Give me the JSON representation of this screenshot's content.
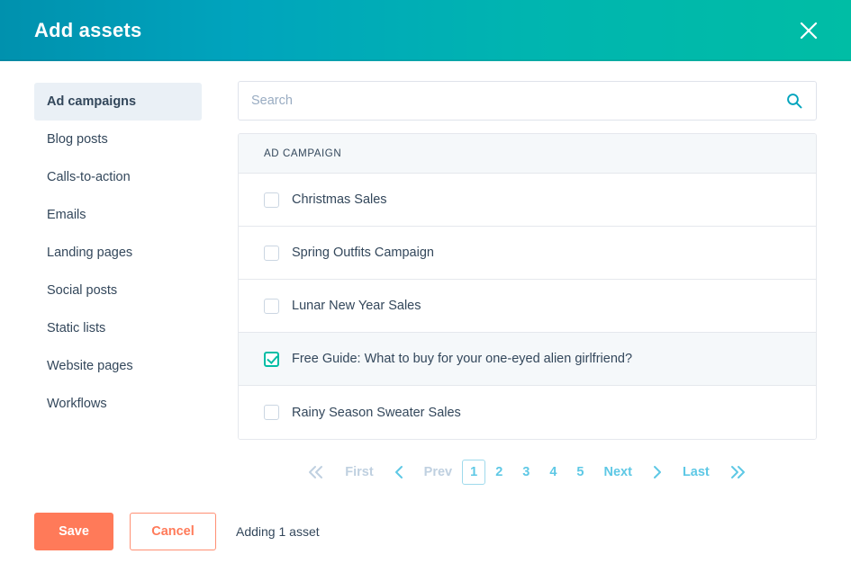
{
  "header": {
    "title": "Add assets",
    "close_label": "Close",
    "gradient_start": "#0091ae",
    "gradient_end": "#00bda5"
  },
  "sidebar": {
    "items": [
      {
        "label": "Ad campaigns",
        "active": true
      },
      {
        "label": "Blog posts",
        "active": false
      },
      {
        "label": "Calls-to-action",
        "active": false
      },
      {
        "label": "Emails",
        "active": false
      },
      {
        "label": "Landing pages",
        "active": false
      },
      {
        "label": "Social posts",
        "active": false
      },
      {
        "label": "Static lists",
        "active": false
      },
      {
        "label": "Website pages",
        "active": false
      },
      {
        "label": "Workflows",
        "active": false
      }
    ]
  },
  "search": {
    "value": "",
    "placeholder": "Search",
    "icon": "search-icon",
    "icon_color": "#00a4bd"
  },
  "table": {
    "column_header": "AD CAMPAIGN",
    "rows": [
      {
        "label": "Christmas Sales",
        "checked": false
      },
      {
        "label": "Spring Outfits Campaign",
        "checked": false
      },
      {
        "label": "Lunar New Year Sales",
        "checked": false
      },
      {
        "label": "Free Guide: What to buy for your one-eyed alien girlfriend?",
        "checked": true
      },
      {
        "label": "Rainy Season Sweater Sales",
        "checked": false
      }
    ]
  },
  "pagination": {
    "first_label": "First",
    "prev_label": "Prev",
    "next_label": "Next",
    "last_label": "Last",
    "pages": [
      "1",
      "2",
      "3",
      "4",
      "5"
    ],
    "current_page": "1",
    "accent_color": "#5ec8e5",
    "disabled_color": "#bfd0e0"
  },
  "footer": {
    "save_label": "Save",
    "cancel_label": "Cancel",
    "note": "Adding 1 asset",
    "primary_color": "#ff7a59"
  }
}
